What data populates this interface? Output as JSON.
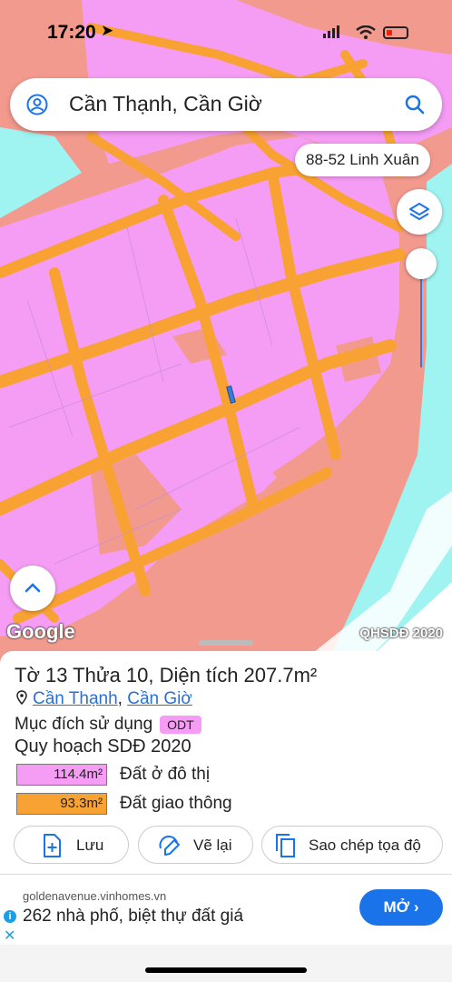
{
  "status": {
    "time": "17:20"
  },
  "search": {
    "title": "Cần Thạnh, Cần Giờ"
  },
  "chip": {
    "label": "88-52 Linh Xuân"
  },
  "map": {
    "attribution": "Google",
    "layer_label": "QHSDĐ 2020"
  },
  "sheet": {
    "headline": "Tờ 13 Thửa 10, Diện tích 207.7m²",
    "commune": "Cần Thạnh",
    "separator": ",",
    "district": "Cần Giờ",
    "purpose_label": "Mục đích sử dụng",
    "purpose_code": "ODT",
    "plan_title": "Quy hoạch SDĐ 2020",
    "areas": [
      {
        "value": "114.4m²",
        "label": "Đất ở đô thị",
        "color": "#f59cf4"
      },
      {
        "value": "93.3m²",
        "label": "Đất giao thông",
        "color": "#f7a233"
      }
    ],
    "buttons": {
      "save": "Lưu",
      "redraw": "Vẽ lại",
      "copy": "Sao chép tọa độ"
    }
  },
  "ad": {
    "domain": "goldenavenue.vinhomes.vn",
    "text": "262 nhà phố, biệt thự đất giá",
    "open": "MỞ"
  },
  "colors": {
    "accent": "#1a73e8",
    "residential": "#f59cf4",
    "road": "#f7a233",
    "water": "#9ff3f1"
  }
}
